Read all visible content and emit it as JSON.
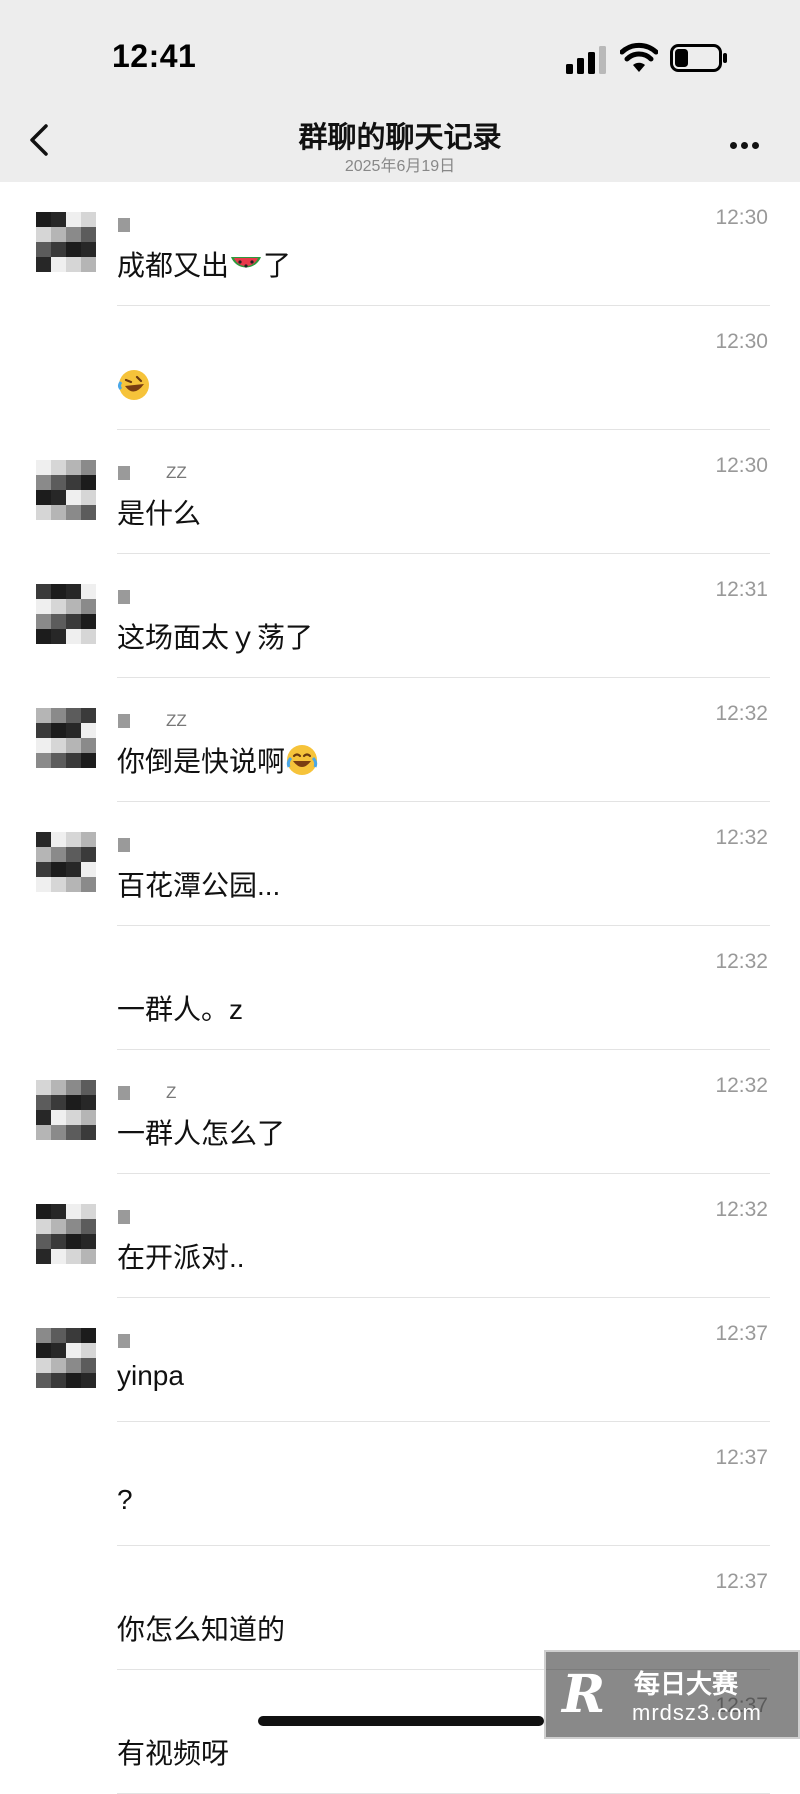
{
  "status": {
    "time": "12:41"
  },
  "nav": {
    "title": "群聊的聊天记录",
    "date": "2025年6月19日"
  },
  "messages": [
    {
      "name": "",
      "time": "12:30",
      "text": "成都又出",
      "emoji": "watermelon-emoji",
      "after": "了",
      "avatar": true
    },
    {
      "name": "",
      "time": "12:30",
      "text": "",
      "emoji": "rofl-emoji",
      "after": "",
      "avatar": false
    },
    {
      "name": "ZZ",
      "time": "12:30",
      "text": "是什么",
      "emoji": "",
      "after": "",
      "avatar": true
    },
    {
      "name": "",
      "time": "12:31",
      "text": "这场面太ｙ荡了",
      "emoji": "",
      "after": "",
      "avatar": true
    },
    {
      "name": "ZZ",
      "time": "12:32",
      "text": "你倒是快说啊",
      "emoji": "joy-emoji",
      "after": "",
      "avatar": true
    },
    {
      "name": "",
      "time": "12:32",
      "text": "百花潭公园...",
      "emoji": "",
      "after": "",
      "avatar": true
    },
    {
      "name": "",
      "time": "12:32",
      "text": "一群人。z",
      "emoji": "",
      "after": "",
      "avatar": false
    },
    {
      "name": "Z",
      "time": "12:32",
      "text": "一群人怎么了",
      "emoji": "",
      "after": "",
      "avatar": true
    },
    {
      "name": "",
      "time": "12:32",
      "text": "在开派对..",
      "emoji": "",
      "after": "",
      "avatar": true
    },
    {
      "name": "",
      "time": "12:37",
      "text": "yinpa",
      "emoji": "",
      "after": "",
      "avatar": true
    },
    {
      "name": "",
      "time": "12:37",
      "text": "?",
      "emoji": "",
      "after": "",
      "avatar": false
    },
    {
      "name": "",
      "time": "12:37",
      "text": "你怎么知道的",
      "emoji": "",
      "after": "",
      "avatar": false
    },
    {
      "name": "",
      "time": "12:37",
      "text": "有视频呀",
      "emoji": "",
      "after": "",
      "avatar": false
    }
  ],
  "watermark": {
    "cn": "每日大赛",
    "url": "mrdsz3.com"
  },
  "colors": {
    "nav_bg": "#ededed",
    "divider": "#e3e3e3",
    "time_gray": "#999999"
  }
}
